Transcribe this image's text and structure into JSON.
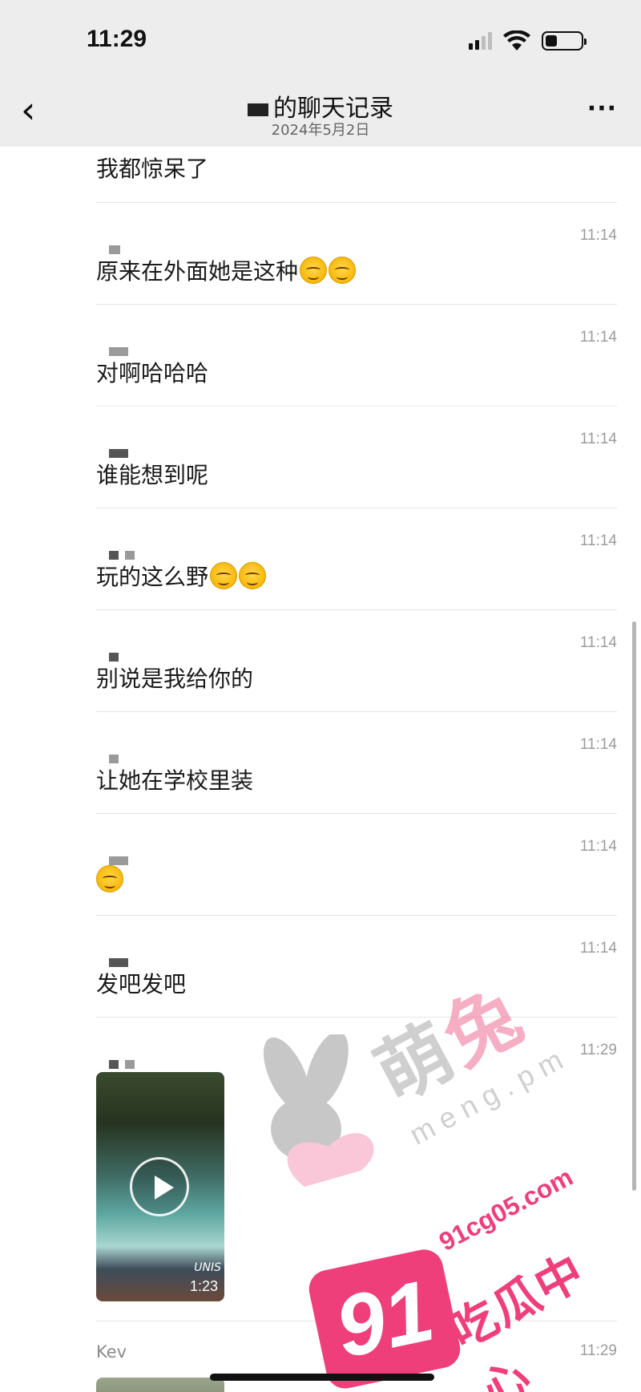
{
  "status_bar": {
    "time": "11:29"
  },
  "nav": {
    "back_icon": "‹",
    "title": "的聊天记录",
    "date": "2024年5月2日",
    "more_icon": "···"
  },
  "messages": [
    {
      "text": "我都惊呆了"
    },
    {
      "time": "11:14",
      "text": "原来在外面她是这种",
      "emoji_count": 2
    },
    {
      "time": "11:14",
      "text": "对啊哈哈哈"
    },
    {
      "time": "11:14",
      "text": "谁能想到呢"
    },
    {
      "time": "11:14",
      "text": "玩的这么野",
      "emoji_count": 2
    },
    {
      "time": "11:14",
      "text": "别说是我给你的"
    },
    {
      "time": "11:14",
      "text": "让她在学校里装"
    },
    {
      "time": "11:14",
      "text": "",
      "emoji_count": 1
    },
    {
      "time": "11:14",
      "text": "发吧发吧"
    },
    {
      "time": "11:29",
      "video": {
        "duration": "1:23",
        "logo": "UNIS"
      }
    },
    {
      "sender": "Kev",
      "time": "11:29"
    }
  ],
  "watermark": {
    "meng_big": "萌",
    "meng_big_accent": "兔",
    "meng_small": "meng.pm",
    "badge": "91",
    "site": "91cg05.com",
    "site_cn": "吃瓜中心"
  },
  "colors": {
    "bar_bg": "#ededed",
    "watermark_pink": "#ef3f7a"
  }
}
